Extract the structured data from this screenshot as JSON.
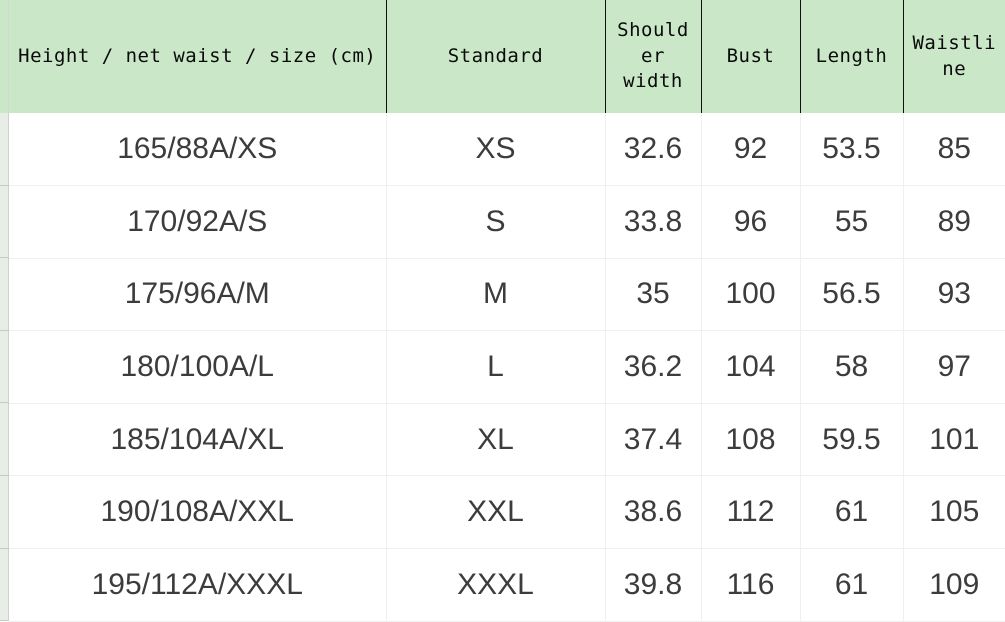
{
  "table": {
    "headers": [
      "Height / net waist / size (cm)",
      "Standard",
      "Shoulder width",
      "Bust",
      "Length",
      "Waistline"
    ],
    "rows": [
      {
        "size_code": "165/88A/XS",
        "standard": "XS",
        "shoulder_width": "32.6",
        "bust": "92",
        "length": "53.5",
        "waistline": "85"
      },
      {
        "size_code": "170/92A/S",
        "standard": "S",
        "shoulder_width": "33.8",
        "bust": "96",
        "length": "55",
        "waistline": "89"
      },
      {
        "size_code": "175/96A/M",
        "standard": "M",
        "shoulder_width": "35",
        "bust": "100",
        "length": "56.5",
        "waistline": "93"
      },
      {
        "size_code": "180/100A/L",
        "standard": "L",
        "shoulder_width": "36.2",
        "bust": "104",
        "length": "58",
        "waistline": "97"
      },
      {
        "size_code": "185/104A/XL",
        "standard": "XL",
        "shoulder_width": "37.4",
        "bust": "108",
        "length": "59.5",
        "waistline": "101"
      },
      {
        "size_code": "190/108A/XXL",
        "standard": "XXL",
        "shoulder_width": "38.6",
        "bust": "112",
        "length": "61",
        "waistline": "105"
      },
      {
        "size_code": "195/112A/XXXL",
        "standard": "XXXL",
        "shoulder_width": "39.8",
        "bust": "116",
        "length": "61",
        "waistline": "109"
      }
    ]
  },
  "row_gutter": {
    "labels": [
      "",
      "",
      "",
      "",
      "",
      "",
      ""
    ]
  },
  "colors": {
    "header_background": "#cae8c8",
    "header_text": "#0a0a0a",
    "header_border": "#111111",
    "body_text": "#3c3c3c",
    "body_border": "#f0f0f0",
    "body_background": "#ffffff"
  }
}
